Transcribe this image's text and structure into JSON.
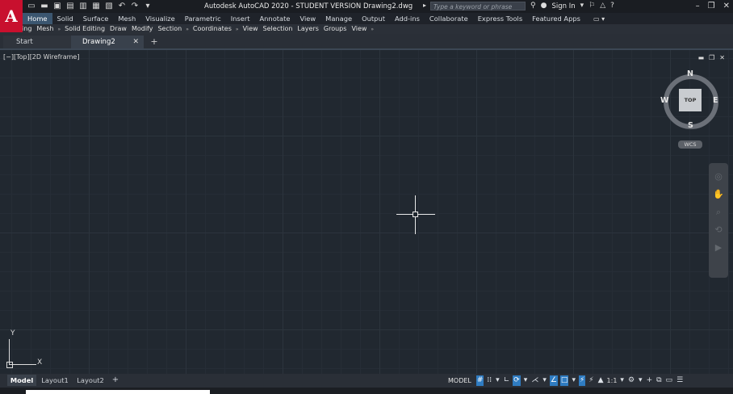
{
  "app": {
    "logo_letter": "A",
    "window_title": "Autodesk AutoCAD 2020 - STUDENT VERSION    Drawing2.dwg",
    "search_placeholder": "Type a keyword or phrase",
    "sign_in": "Sign In",
    "quick_access_icons": [
      "new-file-icon",
      "open-folder-icon",
      "save-icon",
      "save-as-icon",
      "web-mobile-icon",
      "export-icon",
      "print-icon",
      "undo-icon",
      "redo-icon",
      "customize-qat-icon"
    ]
  },
  "ribbon": {
    "tabs": [
      "Home",
      "Solid",
      "Surface",
      "Mesh",
      "Visualize",
      "Parametric",
      "Insert",
      "Annotate",
      "View",
      "Manage",
      "Output",
      "Add-ins",
      "Collaborate",
      "Express Tools",
      "Featured Apps"
    ],
    "active_tab": "Home"
  },
  "panels": [
    "Modeling",
    "Mesh",
    "Solid Editing",
    "Draw",
    "Modify",
    "Section",
    "Coordinates",
    "View",
    "Selection",
    "Layers",
    "Groups",
    "View"
  ],
  "documents": {
    "tabs": [
      "Start",
      "Drawing2"
    ],
    "active": "Drawing2"
  },
  "viewport": {
    "label": "[−][Top][2D Wireframe]",
    "viewcube": {
      "face": "TOP",
      "north": "N",
      "south": "S",
      "east": "E",
      "west": "W"
    },
    "wcs": "WCS",
    "ucs_x": "X",
    "ucs_y": "Y"
  },
  "layouts": {
    "tabs": [
      "Model",
      "Layout1",
      "Layout2"
    ],
    "active": "Model"
  },
  "status": {
    "mode": "MODEL",
    "scale": "1:1"
  },
  "colors": {
    "canvas": "#212830",
    "accent": "#2f7cc2",
    "logo": "#c8102e"
  }
}
